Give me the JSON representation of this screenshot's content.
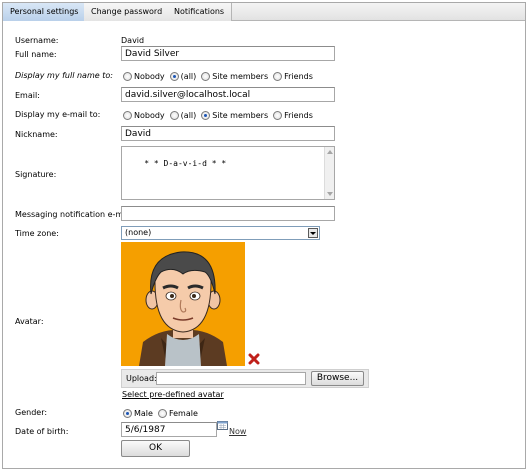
{
  "tabs": [
    {
      "label": "Personal settings",
      "active": true
    },
    {
      "label": "Change password",
      "active": false
    },
    {
      "label": "Notifications",
      "active": false
    }
  ],
  "form": {
    "username_label": "Username:",
    "username_value": "David",
    "fullname_label": "Full name:",
    "fullname_value": "David Silver",
    "display_name_label": "Display my full name to:",
    "display_name_options": [
      "Nobody",
      "(all)",
      "Site members",
      "Friends"
    ],
    "display_name_selected": "(all)",
    "email_label": "Email:",
    "email_value": "david.silver@localhost.local",
    "display_email_label": "Display my e-mail to:",
    "display_email_options": [
      "Nobody",
      "(all)",
      "Site members",
      "Friends"
    ],
    "display_email_selected": "Site members",
    "nickname_label": "Nickname:",
    "nickname_value": "David",
    "signature_label": "Signature:",
    "signature_value": "* * D-a-v-i-d * *",
    "messaging_label": "Messaging notification e-mail:",
    "messaging_value": "",
    "timezone_label": "Time zone:",
    "timezone_value": "(none)",
    "avatar_label": "Avatar:",
    "upload_label": "Upload:",
    "browse_label": "Browse...",
    "predefined_link": "Select pre-defined avatar",
    "gender_label": "Gender:",
    "gender_options": [
      "Male",
      "Female"
    ],
    "gender_selected": "Male",
    "dob_label": "Date of birth:",
    "dob_value": "5/6/1987",
    "now_link": "Now",
    "ok_label": "OK"
  },
  "icons": {
    "avatar_delete": "delete-x-icon",
    "calendar": "calendar-icon",
    "dropdown": "chevron-down-icon"
  },
  "colors": {
    "active_tab": "#c6daf0",
    "avatar_background": "#f59f00",
    "delete_icon": "#c0201b"
  }
}
